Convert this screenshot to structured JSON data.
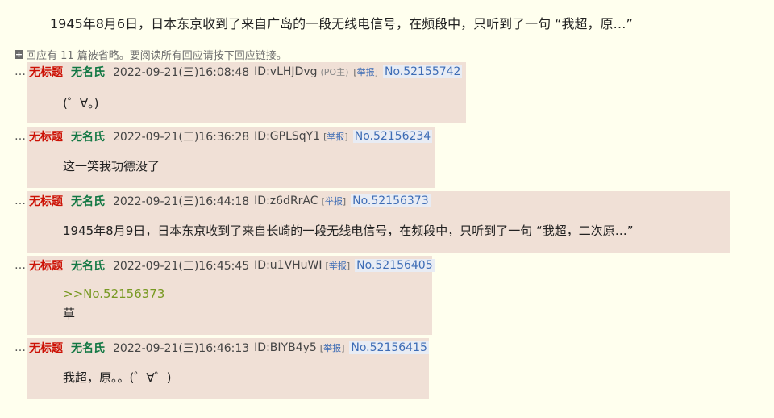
{
  "op": {
    "text": "1945年8月6日，日本东京收到了来自广岛的一段无线电信号，在频段中，只听到了一句 “我超，原…”"
  },
  "omitted": {
    "icon": "plus-square-icon",
    "text": "回应有 11 篇被省略。要阅读所有回应请按下回应链接。"
  },
  "replies": [
    {
      "dots": "…",
      "title": "无标题",
      "name": "无名氏",
      "datetime": "2022-09-21(三)16:08:48",
      "id": "ID:vLHJDvg",
      "po_tag": "(PO主)",
      "report_open": "[",
      "report_label": "举报",
      "report_close": "]",
      "number": "No.52155742",
      "lines": [
        "(゜∀。)"
      ]
    },
    {
      "dots": "…",
      "title": "无标题",
      "name": "无名氏",
      "datetime": "2022-09-21(三)16:36:28",
      "id": "ID:GPLSqY1",
      "report_open": "[",
      "report_label": "举报",
      "report_close": "]",
      "number": "No.52156234",
      "lines": [
        "这一笑我功德没了"
      ]
    },
    {
      "dots": "…",
      "title": "无标题",
      "name": "无名氏",
      "datetime": "2022-09-21(三)16:44:18",
      "id": "ID:z6dRrAC",
      "report_open": "[",
      "report_label": "举报",
      "report_close": "]",
      "number": "No.52156373",
      "lines": [
        "1945年8月9日，日本东京收到了来自长崎的一段无线电信号，在频段中，只听到了一句 “我超，二次原…”"
      ]
    },
    {
      "dots": "…",
      "title": "无标题",
      "name": "无名氏",
      "datetime": "2022-09-21(三)16:45:45",
      "id": "ID:u1VHuWI",
      "report_open": "[",
      "report_label": "举报",
      "report_close": "]",
      "number": "No.52156405",
      "quote": ">>No.52156373",
      "lines": [
        "草"
      ]
    },
    {
      "dots": "…",
      "title": "无标题",
      "name": "无名氏",
      "datetime": "2022-09-21(三)16:46:13",
      "id": "ID:BIYB4y5",
      "report_open": "[",
      "report_label": "举报",
      "report_close": "]",
      "number": "No.52156415",
      "lines": [
        "我超，原。。(゜∀゜)"
      ]
    }
  ],
  "colors": {
    "page_bg": "#ffffee",
    "reply_bg": "#f0e0d6",
    "title": "#cc1105",
    "name": "#117743",
    "link": "#3d6cb5",
    "quote": "#789922"
  }
}
